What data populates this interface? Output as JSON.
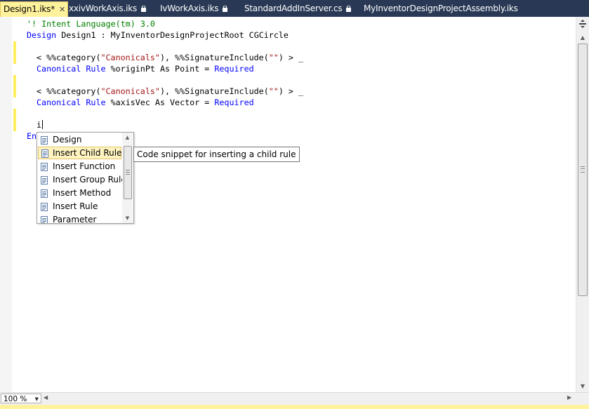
{
  "tabs": [
    {
      "label": "Design1.iks*",
      "active": true,
      "locked": false,
      "close": "✕"
    },
    {
      "label": "xxivWorkAxis.iks",
      "active": false,
      "locked": true
    },
    {
      "label": "IvWorkAxis.iks",
      "active": false,
      "locked": true
    },
    {
      "label": "StandardAddInServer.cs",
      "active": false,
      "locked": true
    },
    {
      "label": "MyInventorDesignProjectAssembly.iks",
      "active": false,
      "locked": false
    }
  ],
  "code": {
    "line1": {
      "comment": "'! Intent Language(tm) 3.0"
    },
    "line2": {
      "kw": "Design",
      "rest": " Design1 : MyInventorDesignProjectRoot CGCircle"
    },
    "line4": {
      "a": "< %%category(",
      "s": "\"Canonicals\"",
      "b": "), %%SignatureInclude(",
      "s2": "\"\"",
      "c": ") > _"
    },
    "line5": {
      "kw1": "Canonical",
      "kw2": "Rule",
      "rest": " %originPt As Point = ",
      "req": "Required"
    },
    "line7": {
      "a": "< %%category(",
      "s": "\"Canonicals\"",
      "b": "), %%SignatureInclude(",
      "s2": "\"\"",
      "c": ") > _"
    },
    "line8": {
      "kw1": "Canonical",
      "kw2": "Rule",
      "rest": " %axisVec As Vector = ",
      "req": "Required"
    },
    "line10": {
      "typed": "i"
    },
    "line11": {
      "partial": "En"
    }
  },
  "completion": {
    "items": [
      {
        "label": "Design",
        "selected": false,
        "icon": "snippet-icon"
      },
      {
        "label": "Insert Child Rule",
        "selected": true,
        "icon": "snippet-icon"
      },
      {
        "label": "Insert Function",
        "selected": false,
        "icon": "snippet-icon"
      },
      {
        "label": "Insert Group Rule",
        "selected": false,
        "icon": "snippet-icon"
      },
      {
        "label": "Insert Method",
        "selected": false,
        "icon": "snippet-icon"
      },
      {
        "label": "Insert Rule",
        "selected": false,
        "icon": "snippet-icon"
      },
      {
        "label": "Parameter",
        "selected": false,
        "icon": "snippet-icon"
      }
    ],
    "tooltip": "Code snippet for inserting a child rule"
  },
  "status": {
    "zoom": "100 %"
  },
  "colors": {
    "keyword": "#0000ff",
    "comment": "#008000",
    "string": "#a31515",
    "tab_active_bg": "#fff29d",
    "chrome_bg": "#293955",
    "change_marker": "#ffee62"
  }
}
